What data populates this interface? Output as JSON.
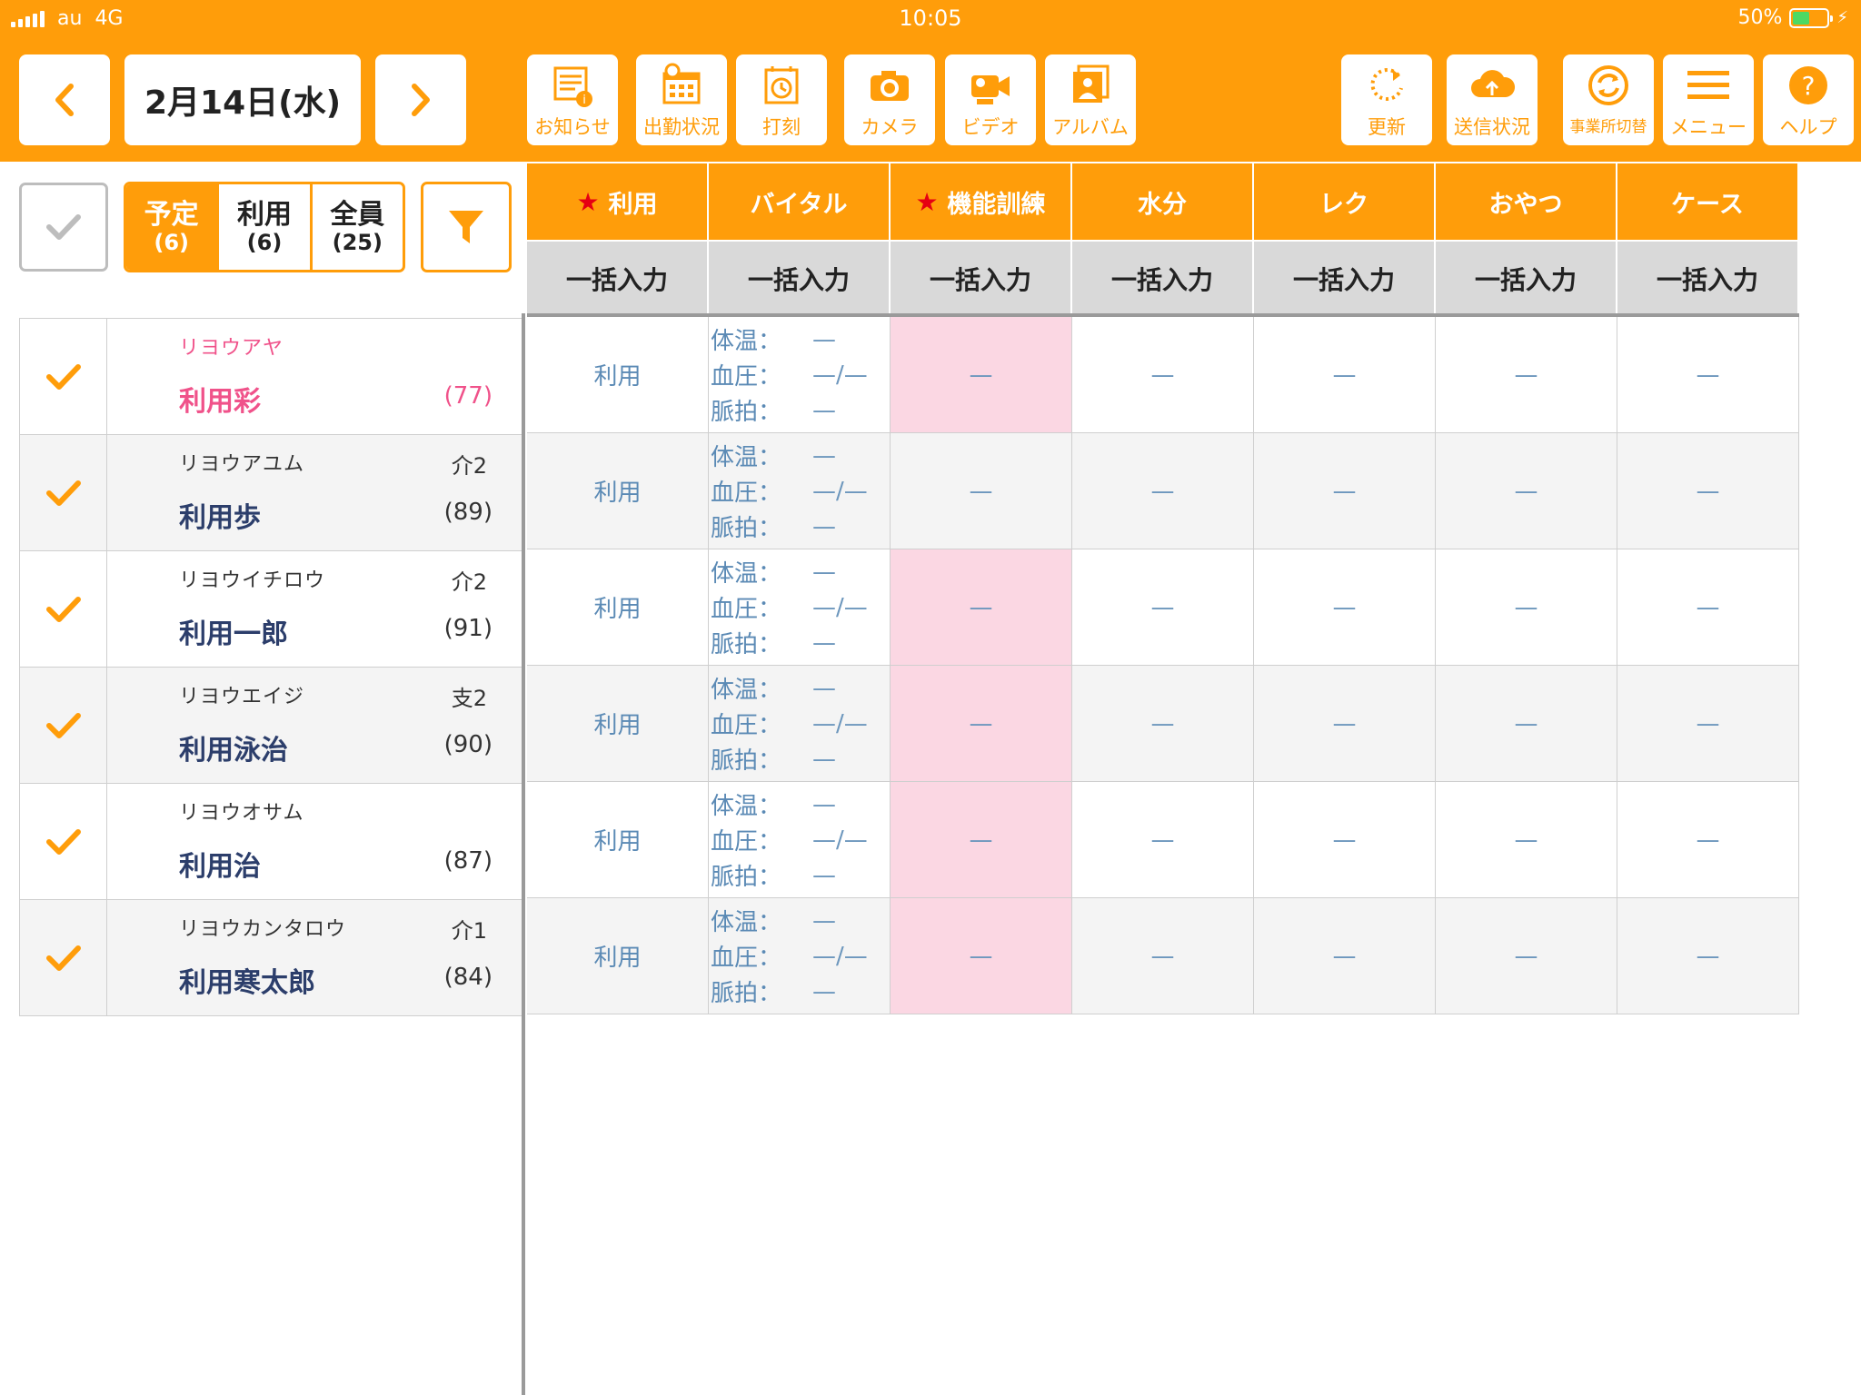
{
  "status_bar": {
    "carrier": "au",
    "network": "4G",
    "time": "10:05",
    "battery": "50%",
    "battery_level": 0.5
  },
  "header": {
    "date": "2月14日(水)",
    "tools_left": [
      {
        "id": "notice",
        "label": "お知らせ",
        "icon": "notice-icon"
      },
      {
        "id": "attendance",
        "label": "出勤状況",
        "icon": "attendance-calendar-icon"
      },
      {
        "id": "stamp",
        "label": "打刻",
        "icon": "timeclock-icon"
      },
      {
        "id": "camera",
        "label": "カメラ",
        "icon": "camera-icon"
      },
      {
        "id": "video",
        "label": "ビデオ",
        "icon": "video-camera-icon"
      },
      {
        "id": "album",
        "label": "アルバム",
        "icon": "album-icon"
      }
    ],
    "tools_right": [
      {
        "id": "refresh",
        "label": "更新",
        "icon": "refresh-icon"
      },
      {
        "id": "send",
        "label": "送信状況",
        "icon": "cloud-upload-icon"
      },
      {
        "id": "office",
        "label": "事業所切替",
        "icon": "switch-office-icon"
      },
      {
        "id": "menu",
        "label": "メニュー",
        "icon": "hamburger-menu-icon"
      },
      {
        "id": "help",
        "label": "ヘルプ",
        "icon": "help-icon"
      }
    ]
  },
  "filter_tabs": [
    {
      "label": "予定",
      "count": "(6)",
      "active": true
    },
    {
      "label": "利用",
      "count": "(6)",
      "active": false
    },
    {
      "label": "全員",
      "count": "(25)",
      "active": false
    }
  ],
  "columns": [
    {
      "label": "利用",
      "star": true,
      "bulk": "一括入力"
    },
    {
      "label": "バイタル",
      "star": false,
      "bulk": "一括入力"
    },
    {
      "label": "機能訓練",
      "star": true,
      "bulk": "一括入力"
    },
    {
      "label": "水分",
      "star": false,
      "bulk": "一括入力"
    },
    {
      "label": "レク",
      "star": false,
      "bulk": "一括入力"
    },
    {
      "label": "おやつ",
      "star": false,
      "bulk": "一括入力"
    },
    {
      "label": "ケース",
      "star": false,
      "bulk": "一括入力"
    }
  ],
  "star_glyph": "★",
  "vital_labels": {
    "temp": "体温：",
    "bp": "血圧：",
    "pulse": "脈拍："
  },
  "residents": [
    {
      "kana": "リヨウアヤ",
      "name": "利用彩",
      "age": "(77)",
      "care": "",
      "checked": true,
      "pink_name": true,
      "usage": "利用",
      "temp": "—",
      "bp": "—/—",
      "pulse": "—",
      "training": "—",
      "training_pending": true,
      "water": "—",
      "rec": "—",
      "snack": "—",
      "case": "—"
    },
    {
      "kana": "リヨウアユム",
      "name": "利用歩",
      "age": "(89)",
      "care": "介2",
      "checked": true,
      "pink_name": false,
      "usage": "利用",
      "temp": "—",
      "bp": "—/—",
      "pulse": "—",
      "training": "—",
      "training_pending": false,
      "water": "—",
      "rec": "—",
      "snack": "—",
      "case": "—"
    },
    {
      "kana": "リヨウイチロウ",
      "name": "利用一郎",
      "age": "(91)",
      "care": "介2",
      "checked": true,
      "pink_name": false,
      "usage": "利用",
      "temp": "—",
      "bp": "—/—",
      "pulse": "—",
      "training": "—",
      "training_pending": true,
      "water": "—",
      "rec": "—",
      "snack": "—",
      "case": "—"
    },
    {
      "kana": "リヨウエイジ",
      "name": "利用泳治",
      "age": "(90)",
      "care": "支2",
      "checked": true,
      "pink_name": false,
      "usage": "利用",
      "temp": "—",
      "bp": "—/—",
      "pulse": "—",
      "training": "—",
      "training_pending": true,
      "water": "—",
      "rec": "—",
      "snack": "—",
      "case": "—"
    },
    {
      "kana": "リヨウオサム",
      "name": "利用治",
      "age": "(87)",
      "care": "",
      "checked": true,
      "pink_name": false,
      "usage": "利用",
      "temp": "—",
      "bp": "—/—",
      "pulse": "—",
      "training": "—",
      "training_pending": true,
      "water": "—",
      "rec": "—",
      "snack": "—",
      "case": "—"
    },
    {
      "kana": "リヨウカンタロウ",
      "name": "利用寒太郎",
      "age": "(84)",
      "care": "介1",
      "checked": true,
      "pink_name": false,
      "usage": "利用",
      "temp": "—",
      "bp": "—/—",
      "pulse": "—",
      "training": "—",
      "training_pending": true,
      "water": "—",
      "rec": "—",
      "snack": "—",
      "case": "—"
    }
  ],
  "colors": {
    "accent": "#ff9d0a",
    "star": "#e60012",
    "pending": "#fbd7e3",
    "name": "#2c3e6b",
    "highlight_name": "#f0528a",
    "value": "#5b8ab5"
  }
}
